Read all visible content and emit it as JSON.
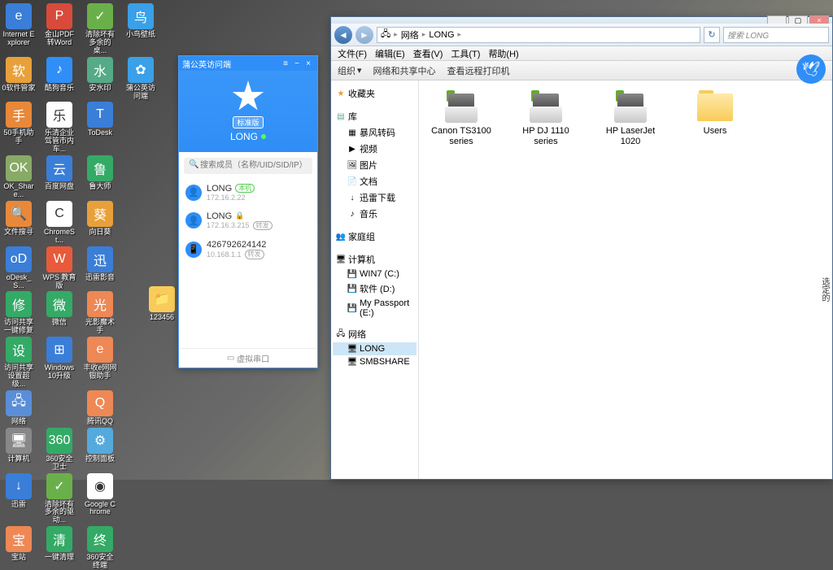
{
  "desktop_icons": {
    "r0c0": "Internet Explorer",
    "r0c1": "金山PDF转Word",
    "r0c2": "清除坏有多余的桌...",
    "r0c3": "小鸟壁纸",
    "r1c0": "0软件管家",
    "r1c1": "酷狗音乐",
    "r1c2": "安水印",
    "r1c3": "蒲公英访问端",
    "r2c0": "50手机助手",
    "r2c1": "乐清企业驾管市内车...",
    "r2c2": "ToDesk",
    "r3c0": "OK_Share...",
    "r3c1": "百度网盘",
    "r3c2": "鲁大师",
    "r4c0": "文件搜寻",
    "r4c1": "ChromeSt...",
    "r4c2": "向日葵",
    "r5c0": "oDesk_S...",
    "r5c1": "WPS 教育版",
    "r5c2": "迅雷影音",
    "r6c0": "访问共享一键修复",
    "r6c1": "微信",
    "r6c2": "光影魔术手",
    "r7c0": "访问共享设置超级...",
    "r7c1": "Windows 10升级",
    "r7c2": "丰收e网网银助手",
    "r8c0": "网络",
    "r8c2": "腾讯QQ",
    "r9c0": "计算机",
    "r9c1": "360安全卫士",
    "r9c2": "控制面板",
    "r10c0": "迅雷",
    "r10c1": "清除坏有多余的驱动...",
    "r10c2": "Google Chrome",
    "r11c0": "宝站",
    "r11c1": "一键清理",
    "r11c2": "360安全终端",
    "folder_123456": "123456"
  },
  "vpn": {
    "title": "蒲公英访问端",
    "badge": "标准版",
    "name": "LONG",
    "search_placeholder": "搜索成员（名称/UID/SID/IP）",
    "members": [
      {
        "name": "LONG",
        "ip": "172.16.2.22",
        "tag": "本机"
      },
      {
        "name": "LONG",
        "ip": "172.16.3.215",
        "tag": "转发",
        "lock": true
      },
      {
        "name": "426792624142",
        "ip": "10.168.1.1",
        "tag": "转发"
      }
    ],
    "footer": "虚拟串口"
  },
  "explorer": {
    "breadcrumb": {
      "root": "网络",
      "current": "LONG"
    },
    "search_placeholder": "搜索 LONG",
    "menu": {
      "file": "文件(F)",
      "edit": "编辑(E)",
      "view": "查看(V)",
      "tools": "工具(T)",
      "help": "帮助(H)"
    },
    "toolbar": {
      "organize": "组织",
      "share": "网络和共享中心",
      "remote": "查看远程打印机"
    },
    "tree": {
      "favorites": "收藏夹",
      "library": "库",
      "lib_items": {
        "bf": "暴风转码",
        "video": "视频",
        "picture": "图片",
        "document": "文档",
        "thunder": "迅雷下载",
        "music": "音乐"
      },
      "homegroup": "家庭组",
      "computer": "计算机",
      "comp_items": {
        "c": "WIN7 (C:)",
        "d": "软件 (D:)",
        "e": "My Passport (E:)"
      },
      "network": "网络",
      "net_items": {
        "long": "LONG",
        "smb": "SMBSHARE"
      }
    },
    "items": [
      {
        "type": "printer",
        "label": "Canon TS3100 series"
      },
      {
        "type": "printer",
        "label": "HP DJ 1110 series"
      },
      {
        "type": "printer",
        "label": "HP LaserJet 1020"
      },
      {
        "type": "folder",
        "label": "Users"
      }
    ],
    "side_text": "选定的"
  },
  "icon_colors": {
    "ie": "#3a7ed8",
    "pdf": "#d84a3a",
    "clean": "#6ab04a",
    "bird": "#3aa0e8",
    "sw": "#e8a03a",
    "kugou": "#2f8ef7",
    "water": "#5a8",
    "vpn": "#3aa0e8",
    "ph": "#e8883a",
    "lq": "#fff",
    "todesk": "#3a7ed8",
    "ok": "#8a6",
    "baidu": "#3a7ed8",
    "lu": "#3a6",
    "search": "#e8883a",
    "chrome": "#fff",
    "sun": "#e8a03a",
    "od": "#3a7ed8",
    "wps": "#e85a3a",
    "xl": "#3a7ed8",
    "fix": "#3a6",
    "wx": "#3a6",
    "mg": "#e85",
    "set": "#3a6",
    "w10": "#3a7ed8",
    "bank": "#e85",
    "net": "#5a8ed8",
    "qq": "#e85",
    "pc": "#888",
    "360": "#3a6",
    "cp": "#5ad",
    "th": "#3a7ed8",
    "cl2": "#6ab04a",
    "gc": "#fff",
    "bz": "#e85",
    "clean2": "#3a6",
    "360t": "#3a6",
    "folder": "#f8cc5a"
  }
}
